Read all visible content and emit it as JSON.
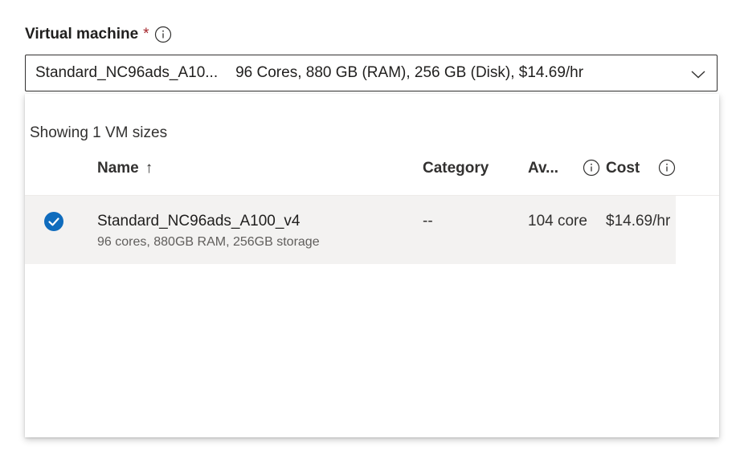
{
  "field": {
    "label": "Virtual machine",
    "required_mark": "*"
  },
  "select": {
    "selected_name": "Standard_NC96ads_A10...",
    "selected_specs": "96 Cores, 880 GB (RAM), 256 GB (Disk), $14.69/hr"
  },
  "dropdown": {
    "showing_text": "Showing 1 VM sizes",
    "columns": {
      "name": "Name",
      "sort_indicator": "↑",
      "category": "Category",
      "availability": "Av...",
      "cost": "Cost"
    },
    "rows": [
      {
        "name": "Standard_NC96ads_A100_v4",
        "description": "96 cores, 880GB RAM, 256GB storage",
        "category": "--",
        "availability": "104 core",
        "cost": "$14.69/hr",
        "selected": true
      }
    ]
  },
  "colors": {
    "accent": "#0f6cbd",
    "required": "#a4262c",
    "row_selected_bg": "#f3f2f1"
  },
  "icons": {
    "info": "info-icon",
    "chevron": "chevron-down-icon",
    "check": "check-circle-icon"
  }
}
